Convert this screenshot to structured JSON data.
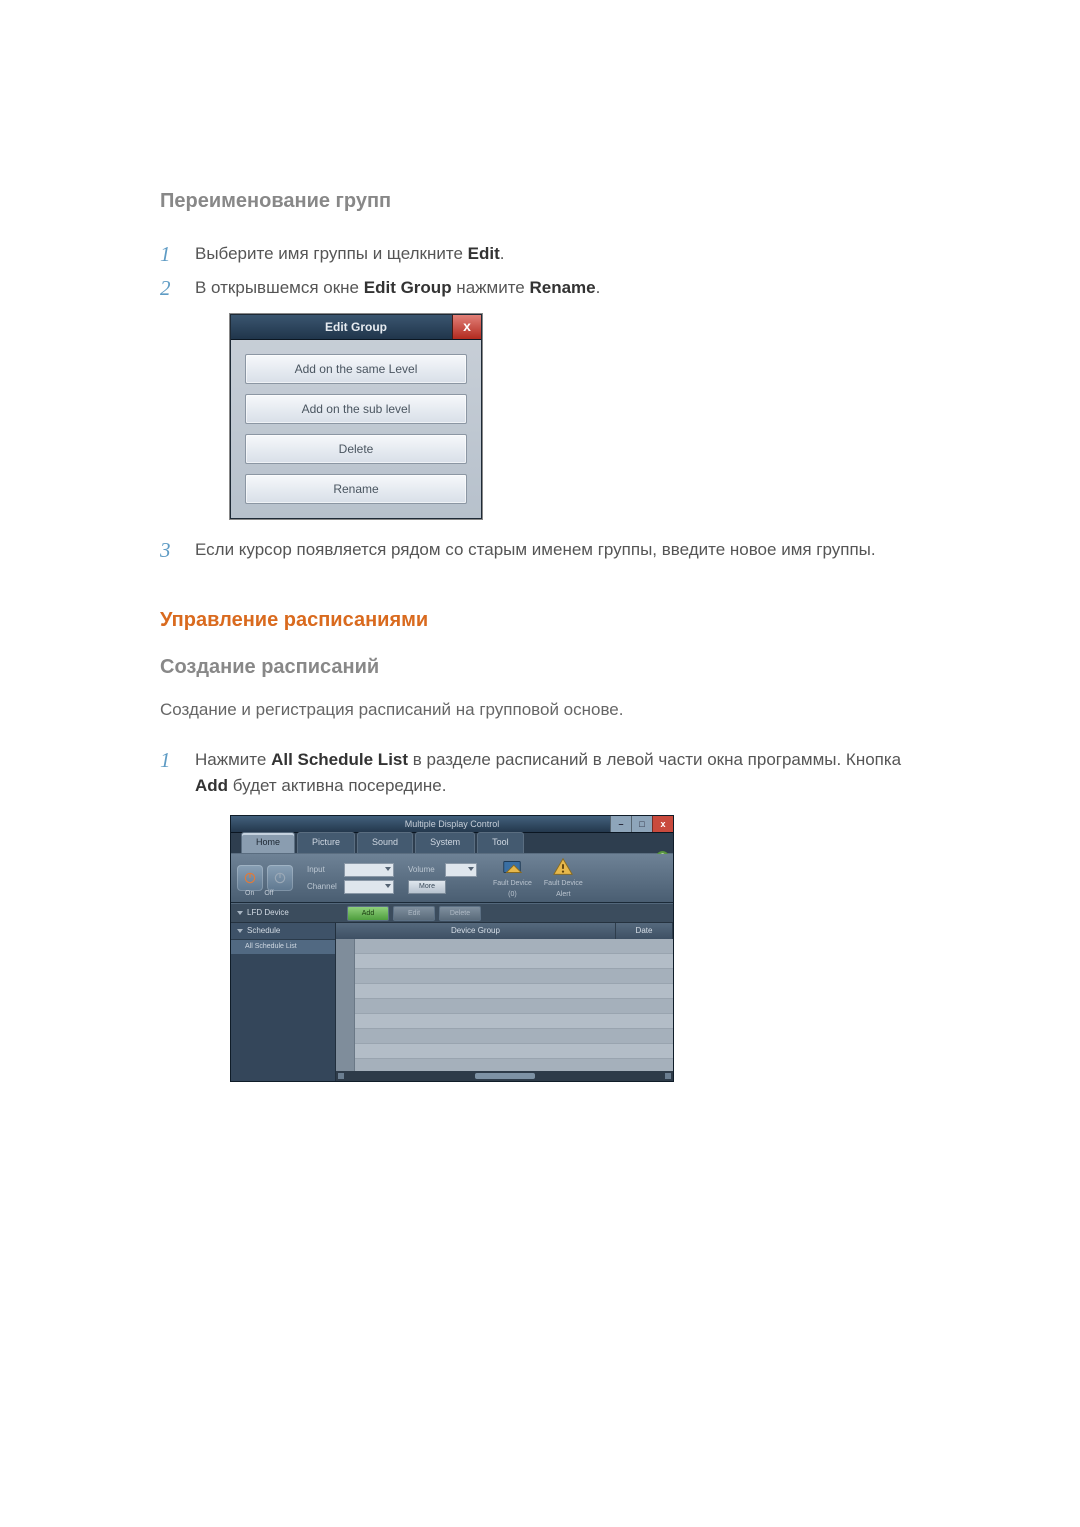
{
  "section1_title": "Переименование групп",
  "step1_a": "Выберите имя группы и щелкните ",
  "step1_b": "Edit",
  "step1_c": ".",
  "step2_a": "В открывшемся окне ",
  "step2_b": "Edit Group",
  "step2_c": " нажмите ",
  "step2_d": "Rename",
  "step2_e": ".",
  "dialog": {
    "title": "Edit Group",
    "close": "x",
    "btn1": "Add on the same Level",
    "btn2": "Add on the sub level",
    "btn3": "Delete",
    "btn4": "Rename"
  },
  "step3": "Если курсор появляется рядом со старым именем группы, введите новое имя группы.",
  "section2_title": "Управление расписаниями",
  "sub2": "Создание расписаний",
  "body2": "Создание и регистрация расписаний на групповой основе.",
  "s2step1_a": "Нажмите ",
  "s2step1_b": "All Schedule List",
  "s2step1_c": " в разделе расписаний в левой части окна программы. Кнопка ",
  "s2step1_d": "Add",
  "s2step1_e": " будет активна посередине.",
  "mdc": {
    "title": "Multiple Display Control",
    "help": "?",
    "win_min": "–",
    "win_max": "□",
    "win_close": "x",
    "tabs": {
      "home": "Home",
      "picture": "Picture",
      "sound": "Sound",
      "system": "System",
      "tool": "Tool"
    },
    "ribbon": {
      "on": "On",
      "off": "Off",
      "input": "Input",
      "channel": "Channel",
      "volume": "Volume",
      "more": "More",
      "fault0": "Fault Device",
      "fault0b": "(0)",
      "fault1": "Fault Device",
      "fault1b": "Alert"
    },
    "side": {
      "lfd": "LFD Device",
      "schedule": "Schedule",
      "all": "All Schedule List"
    },
    "actions": {
      "add": "Add",
      "edit": "Edit",
      "delete": "Delete"
    },
    "cols": {
      "group": "Device Group",
      "date": "Date"
    }
  }
}
